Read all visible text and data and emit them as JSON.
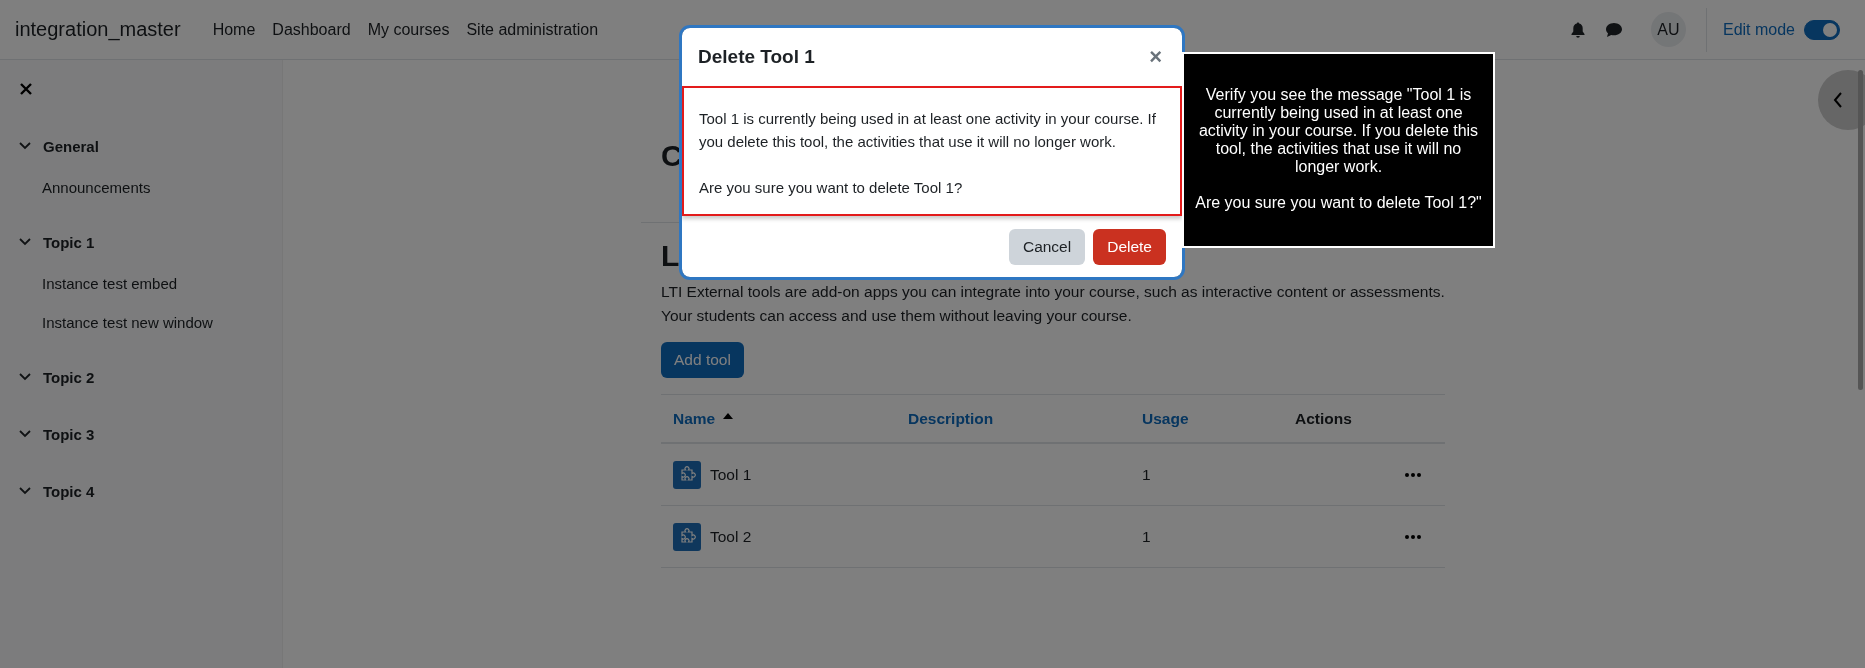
{
  "navbar": {
    "brand": "integration_master",
    "links": [
      "Home",
      "Dashboard",
      "My courses",
      "Site administration"
    ],
    "avatar": "AU",
    "edit_mode": {
      "label": "Edit mode",
      "on": true
    }
  },
  "drawer": {
    "items": [
      {
        "label": "General",
        "expanded": true,
        "children": [
          {
            "label": "Announcements"
          }
        ]
      },
      {
        "label": "Topic 1",
        "expanded": true,
        "children": [
          {
            "label": "Instance test embed"
          },
          {
            "label": "Instance test new window"
          }
        ]
      },
      {
        "label": "Topic 2",
        "expanded": true
      },
      {
        "label": "Topic 3",
        "expanded": true
      },
      {
        "label": "Topic 4",
        "expanded": true
      }
    ]
  },
  "page": {
    "heading": "C",
    "subheading": "L",
    "description": "LTI External tools are add-on apps you can integrate into your course, such as interactive content or assessments. Your students can access and use them without leaving your course.",
    "add_button": "Add tool",
    "table": {
      "columns": [
        {
          "label": "Name",
          "sortable": true,
          "sorted": true
        },
        {
          "label": "Description",
          "sortable": true,
          "sorted": false
        },
        {
          "label": "Usage",
          "sortable": true,
          "sorted": false
        },
        {
          "label": "Actions",
          "sortable": false,
          "sorted": false
        }
      ],
      "rows": [
        {
          "name": "Tool 1",
          "usage": "1"
        },
        {
          "name": "Tool 2",
          "usage": "1"
        }
      ]
    }
  },
  "modal": {
    "title": "Delete Tool 1",
    "close": "×",
    "body": [
      "Tool 1 is currently being used in at least one activity in your course. If you delete this tool, the activities that use it will no longer work.",
      "Are you sure you want to delete Tool 1?"
    ],
    "buttons": [
      {
        "label": "Cancel",
        "kind": "secondary"
      },
      {
        "label": "Delete",
        "kind": "danger"
      }
    ]
  },
  "tooltip": {
    "paragraphs": [
      "Verify you see the message \"Tool 1 is currently being used in at least one activity in your course. If you delete this tool, the activities that use it will no longer work.",
      "Are you sure you want to delete Tool 1?\""
    ]
  }
}
